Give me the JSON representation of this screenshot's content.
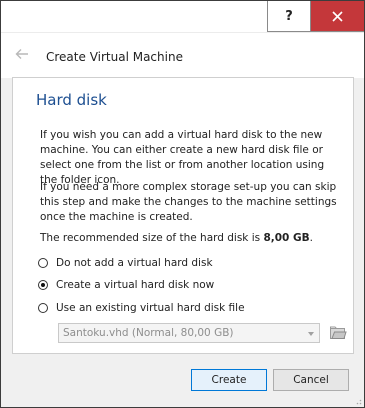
{
  "title_bar": {
    "help_label": "?"
  },
  "header": {
    "title": "Create Virtual Machine"
  },
  "page": {
    "heading": "Hard disk",
    "paragraph1": "If you wish you can add a virtual hard disk to the new machine. You can either create a new hard disk file or select one from the list or from another location using the folder icon.",
    "paragraph2": "If you need a more complex storage set-up you can skip this step and make the changes to the machine settings once the machine is created.",
    "recommended_prefix": "The recommended size of the hard disk is ",
    "recommended_size": "8,00 GB",
    "recommended_suffix": ".",
    "options": [
      {
        "label": "Do not add a virtual hard disk",
        "selected": false
      },
      {
        "label": "Create a virtual hard disk now",
        "selected": true
      },
      {
        "label": "Use an existing virtual hard disk file",
        "selected": false
      }
    ],
    "existing_disk_value": "Santoku.vhd (Normal, 80,00 GB)"
  },
  "footer": {
    "create_label": "Create",
    "cancel_label": "Cancel"
  },
  "colors": {
    "accent_heading": "#1d4f91",
    "close_button": "#c4373a",
    "default_button_border": "#0078d7"
  },
  "icons": [
    "back-arrow-icon",
    "close-icon",
    "folder-icon",
    "chevron-down-icon"
  ]
}
